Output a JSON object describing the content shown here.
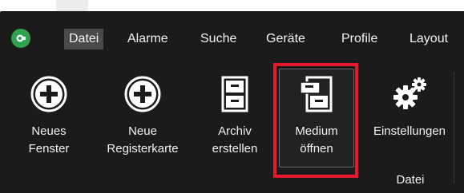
{
  "menu": {
    "items": [
      "Datei",
      "Alarme",
      "Suche",
      "Geräte",
      "Profile",
      "Layout"
    ],
    "active": "Datei"
  },
  "ribbon": {
    "buttons": [
      {
        "line1": "Neues",
        "line2": "Fenster",
        "icon": "plus-circle-icon"
      },
      {
        "line1": "Neue",
        "line2": "Registerkarte",
        "icon": "plus-circle-icon"
      },
      {
        "line1": "Archiv",
        "line2": "erstellen",
        "icon": "file-cabinet-icon"
      },
      {
        "line1": "Medium",
        "line2": "öffnen",
        "icon": "file-cabinet-open-icon"
      },
      {
        "line1": "Einstellungen",
        "line2": "",
        "icon": "gears-icon"
      }
    ],
    "group_label": "Datei"
  },
  "colors": {
    "background": "#1b1b1b",
    "highlight": "#e8192c",
    "logo": "#2ea44f",
    "active_menu": "#4a4a4a"
  }
}
